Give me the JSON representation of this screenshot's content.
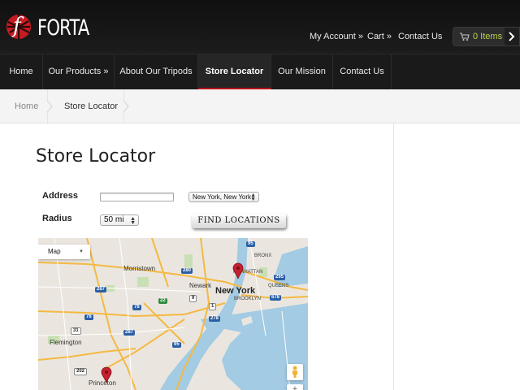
{
  "header": {
    "logo_text": "FORTA",
    "my_account": "My Account »",
    "cart": "Cart »",
    "contact": "Contact Us",
    "cart_count": "0 Items"
  },
  "nav": [
    {
      "label": "Home"
    },
    {
      "label": "Our Products »"
    },
    {
      "label": "About Our Tripods"
    },
    {
      "label": "Store Locator",
      "active": true
    },
    {
      "label": "Our Mission"
    },
    {
      "label": "Contact Us"
    }
  ],
  "breadcrumb": {
    "home": "Home",
    "current": "Store Locator"
  },
  "page": {
    "title": "Store Locator"
  },
  "form": {
    "address_label": "Address",
    "address_value": "",
    "location_select": "New York, New York",
    "radius_label": "Radius",
    "radius_select": "50 mi",
    "find_button": "FIND LOCATIONS"
  },
  "map": {
    "type_control": "Map",
    "labels": {
      "new_york": "New York",
      "newark": "Newark",
      "morristown": "Morristown",
      "flemington": "Flemington",
      "princeton": "Princeton",
      "bronx": "BRONX",
      "manhattan": "MANHATTAN",
      "queens": "QUEENS",
      "brooklyn": "BROOKLYN"
    },
    "shields": {
      "s280": "280",
      "s287a": "287",
      "s287b": "287",
      "s78a": "78",
      "s78b": "78",
      "s95a": "95",
      "s95b": "95",
      "s295": "295",
      "s678": "678",
      "s278": "278",
      "s1": "1",
      "s9": "9",
      "s22": "22",
      "s31": "31",
      "s202": "202"
    }
  },
  "colors": {
    "accent_red": "#b5121b",
    "cart_count": "#b8d24a",
    "water": "#a3cbe3",
    "pin": "#c4202f"
  }
}
